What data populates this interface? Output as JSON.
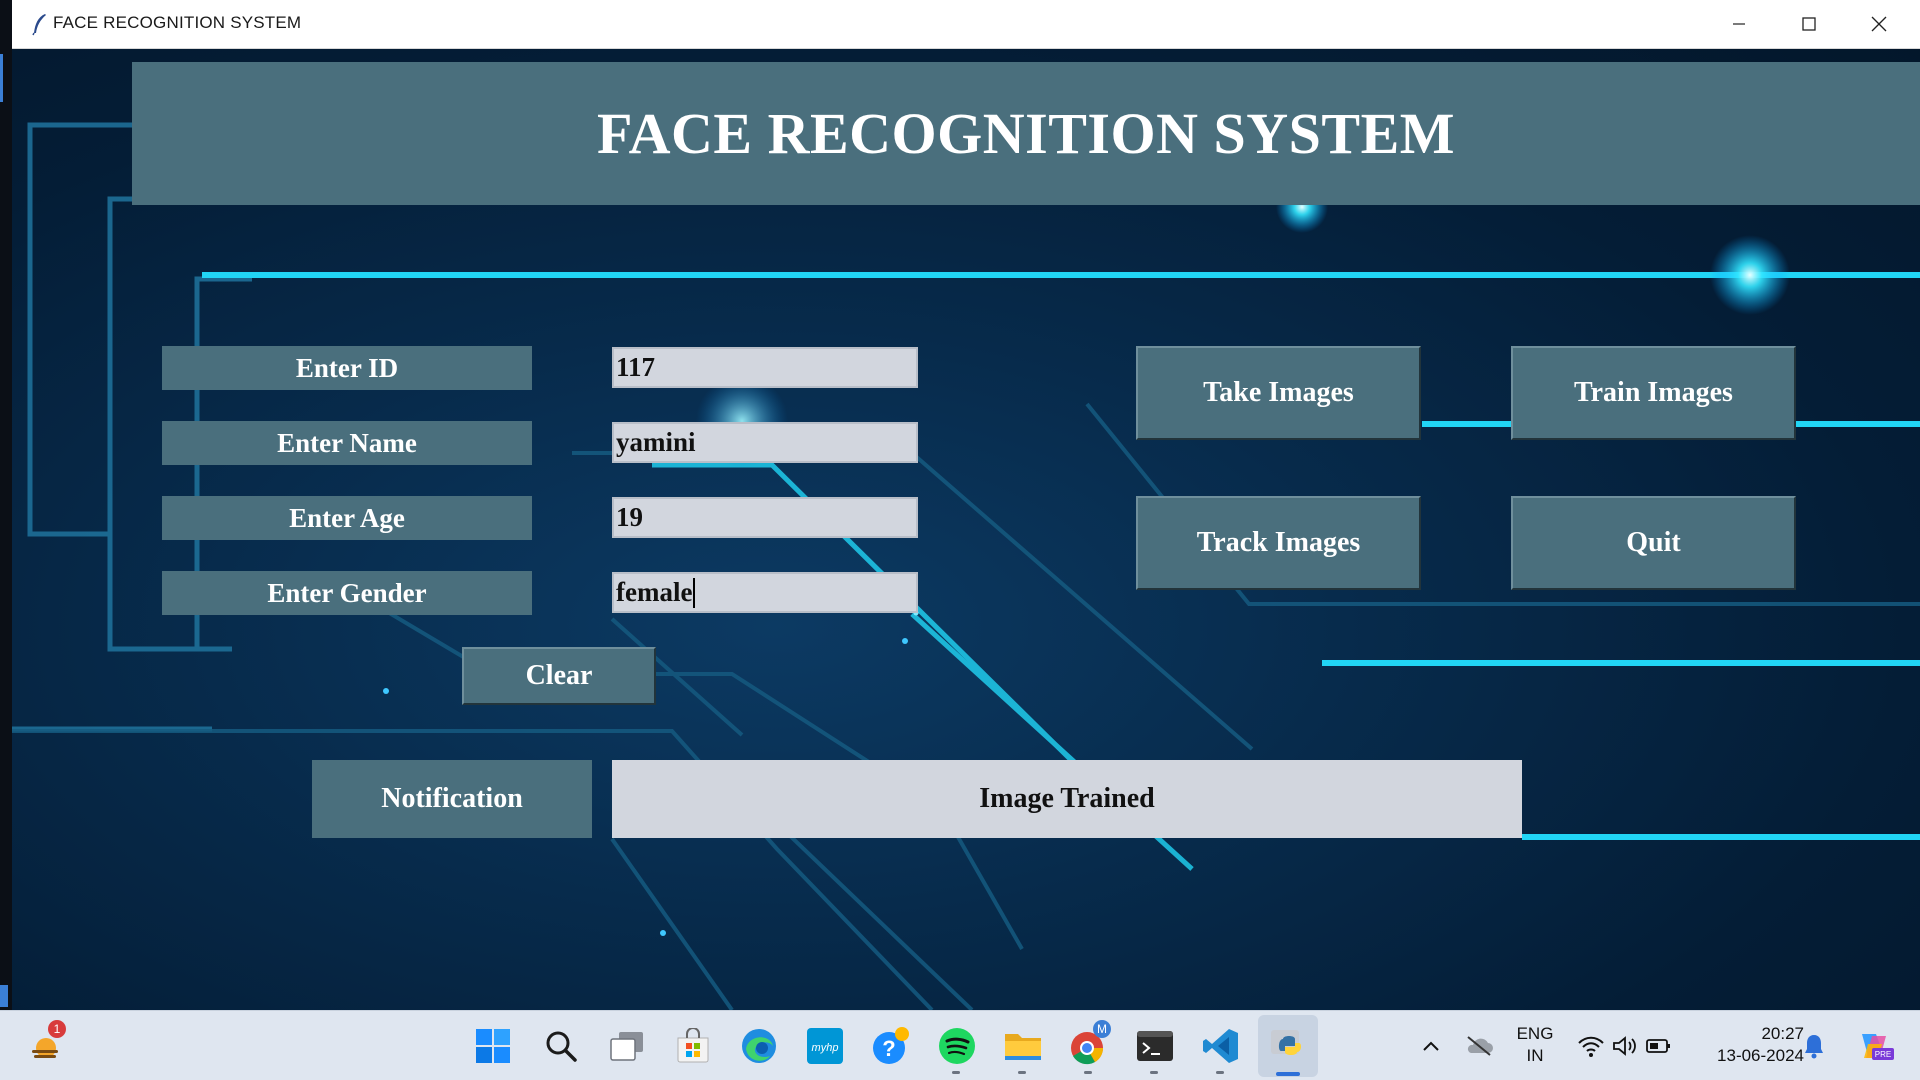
{
  "window": {
    "title": "FACE RECOGNITION SYSTEM",
    "controls": [
      "minimize-icon",
      "maximize-icon",
      "close-icon"
    ]
  },
  "header": {
    "title": "FACE RECOGNITION SYSTEM"
  },
  "form": {
    "id_label": "Enter ID",
    "id_value": "117",
    "name_label": "Enter Name",
    "name_value": "yamini",
    "age_label": "Enter Age",
    "age_value": "19",
    "gender_label": "Enter Gender",
    "gender_value": "female",
    "clear_label": "Clear"
  },
  "actions": {
    "take_images": "Take Images",
    "train_images": "Train Images",
    "track_images": "Track Images",
    "quit": "Quit"
  },
  "notification": {
    "label": "Notification",
    "message": "Image Trained"
  },
  "taskbar": {
    "weather_badge": "1",
    "chrome_badge": "M",
    "pinned": [
      "start-icon",
      "search-icon",
      "task-view-icon",
      "microsoft-store-icon",
      "edge-icon",
      "myhp-icon",
      "get-help-icon",
      "spotify-icon",
      "file-explorer-icon",
      "chrome-icon",
      "terminal-icon",
      "vscode-icon",
      "python-icon"
    ],
    "myhp_text": "myhp",
    "language": "ENG",
    "region": "IN",
    "time": "20:27",
    "date": "13-06-2024",
    "copilot_badge": "PRE"
  },
  "colors": {
    "panel": "#4a6f7d",
    "field": "#d2d6de",
    "background": "#041d36",
    "glow": "#00d8ff"
  }
}
